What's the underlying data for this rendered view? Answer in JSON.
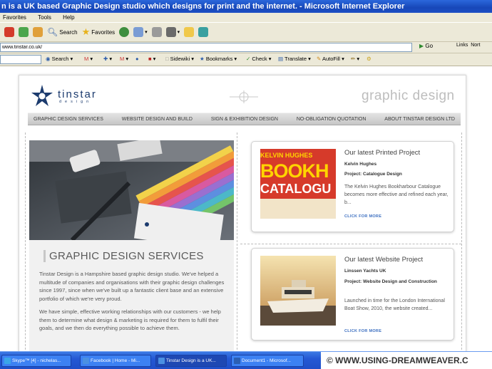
{
  "window": {
    "title": "n is a UK based Graphic Design studio which designs for print and the internet. - Microsoft Internet Explorer"
  },
  "menubar": {
    "items": [
      "Favorites",
      "Tools",
      "Help"
    ]
  },
  "toolbar": {
    "search_label": "Search",
    "favorites_label": "Favorites"
  },
  "address": {
    "value": "www.tinstar.co.uk/",
    "go_label": "Go",
    "links_label": "Links",
    "links_extra": "Nort"
  },
  "google_toolbar": {
    "search_label": "Search",
    "sidewiki_label": "Sidewiki",
    "bookmarks_label": "Bookmarks",
    "check_label": "Check",
    "translate_label": "Translate",
    "autofill_label": "AutoFill"
  },
  "site": {
    "logo_word": "tinstar",
    "logo_sub": "design",
    "tagline": "graphic design",
    "nav": [
      "GRAPHIC DESIGN SERVICES",
      "WEBSITE DESIGN AND BUILD",
      "SIGN & EXHIBITION DESIGN",
      "NO-OBLIGATION QUOTATION",
      "ABOUT TINSTAR DESIGN LTD"
    ],
    "main": {
      "heading": "GRAPHIC DESIGN SERVICES",
      "para1": "Tinstar Design is a Hampshire based graphic design studio. We've helped a multitude of companies and organisations with their graphic design challenges since 1997, since when we've built up a fantastic client base and an extensive portfolio of which we're very proud.",
      "para2": "We have simple, effective working relationships with our customers - we help them to determine what design & marketing is required for them to fulfil their goals, and we then do everything possible to achieve them."
    },
    "card1": {
      "title": "Our latest Printed Project",
      "client": "Kelvin Hughes",
      "project": "Project: Catalogue Design",
      "body": "The Kelvin Hughes Bookharbour Catalogue becomes more effective and refined each year, b...",
      "more": "CLICK FOR MORE",
      "cover_line1": "KELVIN HUGHES",
      "cover_line2": "BOOKH",
      "cover_line3": "CATALOGU"
    },
    "card2": {
      "title": "Our latest Website Project",
      "client": "Linssen Yachts UK",
      "project": "Project: Website Design and Construction",
      "body": "Launched in time for the London International Boat Show, 2010, the website created...",
      "more": "CLICK FOR MORE"
    }
  },
  "taskbar": {
    "tasks": [
      "Skype™ [4] - nichelas...",
      "Facebook | Home - Mi...",
      "Tinstar Design is a UK...",
      "Document1 - Microsof..."
    ],
    "watermark": "© WWW.USING-DREAMWEAVER.C"
  },
  "colors": {
    "title_blue": "#1747b8",
    "logo_blue": "#1c3b6e",
    "taskbar_blue": "#2458d4",
    "link_blue": "#3b6ec0"
  }
}
